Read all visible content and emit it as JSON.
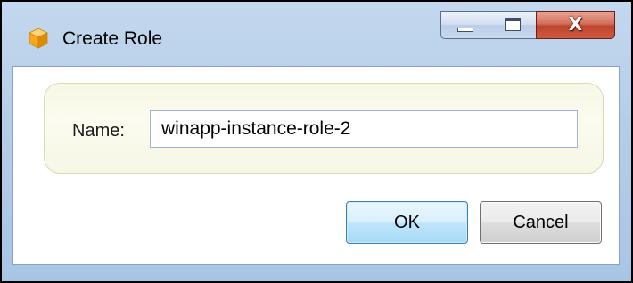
{
  "window": {
    "title": "Create Role",
    "app_icon": "orange-cube-icon",
    "caption_buttons": {
      "minimize_icon": "minimize-icon",
      "maximize_icon": "maximize-icon",
      "close_glyph": "X"
    }
  },
  "form": {
    "name_label": "Name:",
    "name_value": "winapp-instance-role-2"
  },
  "buttons": {
    "ok_label": "OK",
    "cancel_label": "Cancel"
  },
  "colors": {
    "frame": "#b4cde8",
    "groupbox": "#f8f8e6",
    "ok_border": "#3c7fb1",
    "close_button": "#c0442c"
  }
}
